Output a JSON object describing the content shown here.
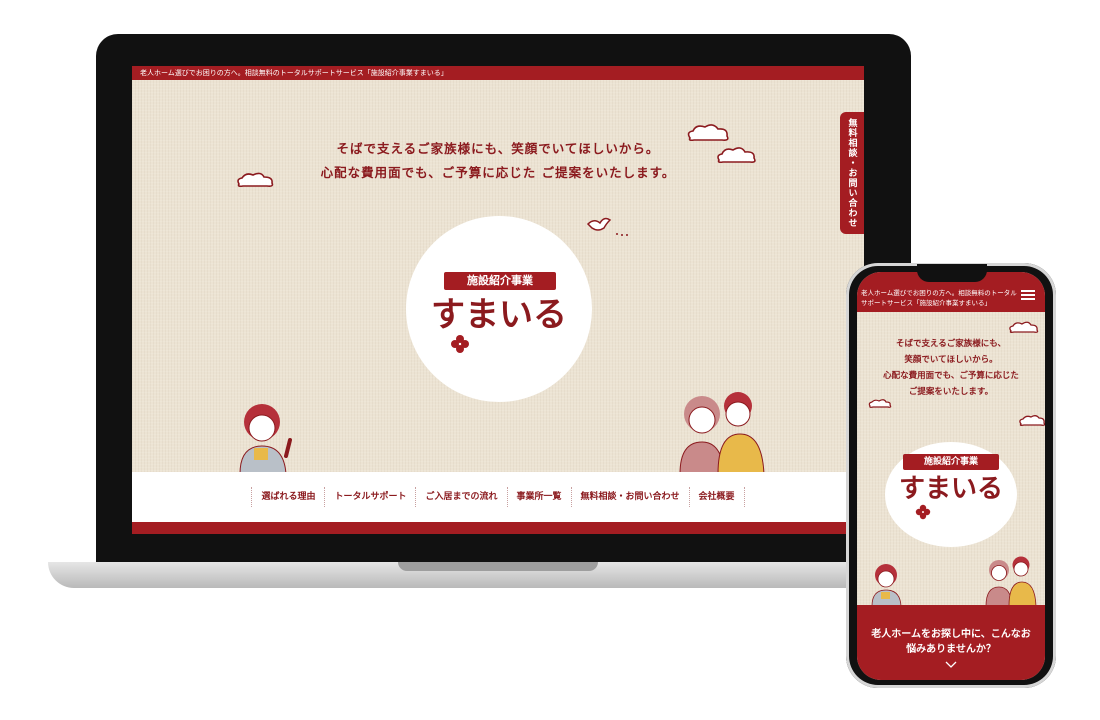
{
  "desktop": {
    "header_text": "老人ホーム選びでお困りの方へ。相談無料のトータルサポートサービス「施設紹介事業すまいる」",
    "tagline_line1": "そばで支えるご家族様にも、笑顔でいてほしいから。",
    "tagline_line2": "心配な費用面でも、ご予算に応じた ご提案をいたします。",
    "side_tab_label": "無料相談・お問い合わせ",
    "logo_ribbon": "施設紹介事業",
    "logo_main": "すまいる",
    "nav_items": [
      "選ばれる理由",
      "トータルサポート",
      "ご入居までの流れ",
      "事業所一覧",
      "無料相談・お問い合わせ",
      "会社概要"
    ]
  },
  "mobile": {
    "header_text": "老人ホーム選びでお困りの方へ。相談無料のトータルサポートサービス「施設紹介事業すまいる」",
    "tagline_lines": [
      "そばで支えるご家族様にも、",
      "笑顔でいてほしいから。",
      "心配な費用面でも、ご予算に応じた",
      "ご提案をいたします。"
    ],
    "logo_ribbon": "施設紹介事業",
    "logo_main": "すまいる",
    "banner_lines": [
      "老人ホームをお探し中に、こんなお",
      "悩みありませんか？"
    ]
  },
  "colors": {
    "accent": "#a41d22",
    "text": "#8b1a1e",
    "background": "#ece3d3",
    "hair_red": "#b5303a",
    "shirt_yellow": "#e8b94a",
    "shirt_gray": "#b9c0c8",
    "pink": "#c98a8a"
  },
  "icons": [
    "cloud-icon",
    "bird-icon",
    "clover-icon",
    "hamburger-menu-icon",
    "chevron-down-icon"
  ]
}
